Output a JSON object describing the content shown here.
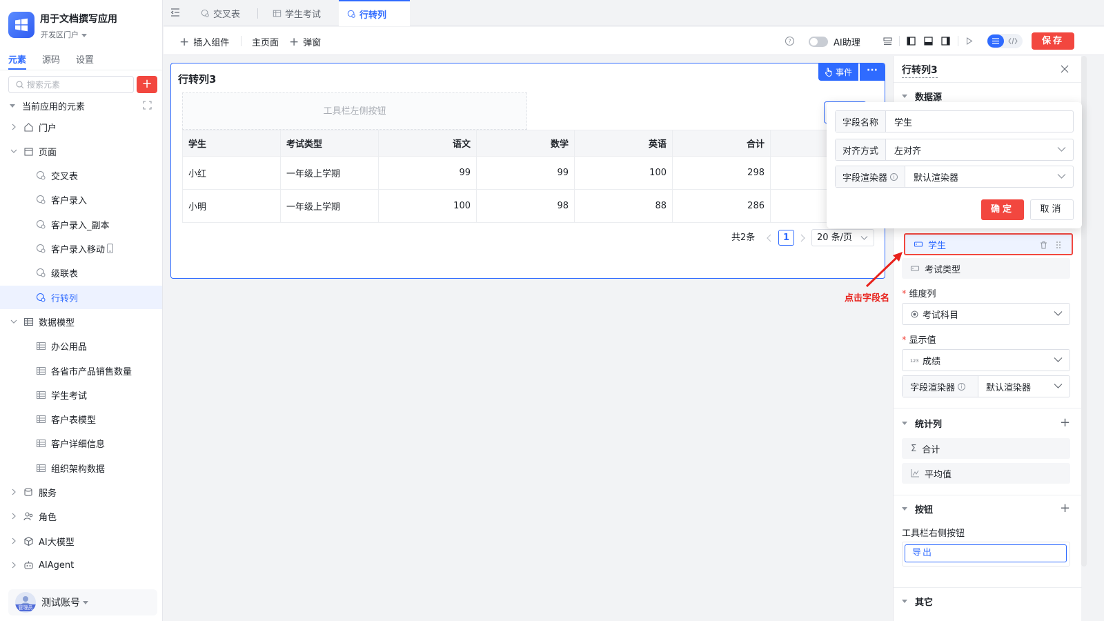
{
  "app": {
    "title": "用于文档撰写应用",
    "portal": "开发区门户"
  },
  "sidebar": {
    "tabs": [
      "元素",
      "源码",
      "设置"
    ],
    "search_placeholder": "搜索元素",
    "add_label": "+",
    "section_title": "当前应用的元素",
    "items": [
      {
        "label": "门户"
      },
      {
        "label": "页面"
      },
      {
        "label": "交叉表"
      },
      {
        "label": "客户录入"
      },
      {
        "label": "客户录入_副本"
      },
      {
        "label": "客户录入移动"
      },
      {
        "label": "级联表"
      },
      {
        "label": "行转列"
      },
      {
        "label": "数据模型"
      },
      {
        "label": "办公用品"
      },
      {
        "label": "各省市产品销售数量"
      },
      {
        "label": "学生考试"
      },
      {
        "label": "客户表模型"
      },
      {
        "label": "客户详细信息"
      },
      {
        "label": "组织架构数据"
      },
      {
        "label": "服务"
      },
      {
        "label": "角色"
      },
      {
        "label": "AI大模型"
      },
      {
        "label": "AIAgent"
      }
    ],
    "account": {
      "name": "测试账号",
      "role": "管理员"
    }
  },
  "tabs": [
    {
      "label": "交叉表"
    },
    {
      "label": "学生考试"
    },
    {
      "label": "行转列"
    }
  ],
  "toolbar": {
    "insert": "插入组件",
    "main_page": "主页面",
    "popup": "弹窗",
    "ai_assistant": "AI助理",
    "save": "保存"
  },
  "card": {
    "title": "行转列3",
    "event_btn": "事件",
    "more_btn": "···",
    "toolbar_left": "工具栏左侧按钮",
    "columns": [
      "学生",
      "考试类型",
      "语文",
      "数学",
      "英语",
      "合计"
    ],
    "rows": [
      [
        "小红",
        "一年级上学期",
        "99",
        "99",
        "100",
        "298"
      ],
      [
        "小明",
        "一年级上学期",
        "100",
        "98",
        "88",
        "286"
      ]
    ],
    "pager": {
      "total": "共2条",
      "current": "1",
      "page_size": "20 条/页"
    }
  },
  "panel": {
    "title": "行转列3",
    "datasource": "数据源",
    "row_fields": [
      "学生",
      "考试类型"
    ],
    "dimension_label": "维度列",
    "dimension_value": "考试科目",
    "display_label": "显示值",
    "display_value": "成绩",
    "renderer_label": "字段渲染器",
    "renderer_value": "默认渲染器",
    "stats_label": "统计列",
    "stats": [
      "合计",
      "平均值"
    ],
    "buttons_label": "按钮",
    "toolbar_right_label": "工具栏右侧按钮",
    "export_btn": "导出",
    "other_label": "其它"
  },
  "popover": {
    "field_name_label": "字段名称",
    "field_name_value": "学生",
    "align_label": "对齐方式",
    "align_value": "左对齐",
    "renderer_label": "字段渲染器",
    "renderer_value": "默认渲染器",
    "ok": "确定",
    "cancel": "取消"
  },
  "annotation": {
    "text": "点击字段名",
    "color": "#e8211b"
  },
  "colors": {
    "primary": "#2f6bff",
    "danger": "#f2473f"
  }
}
